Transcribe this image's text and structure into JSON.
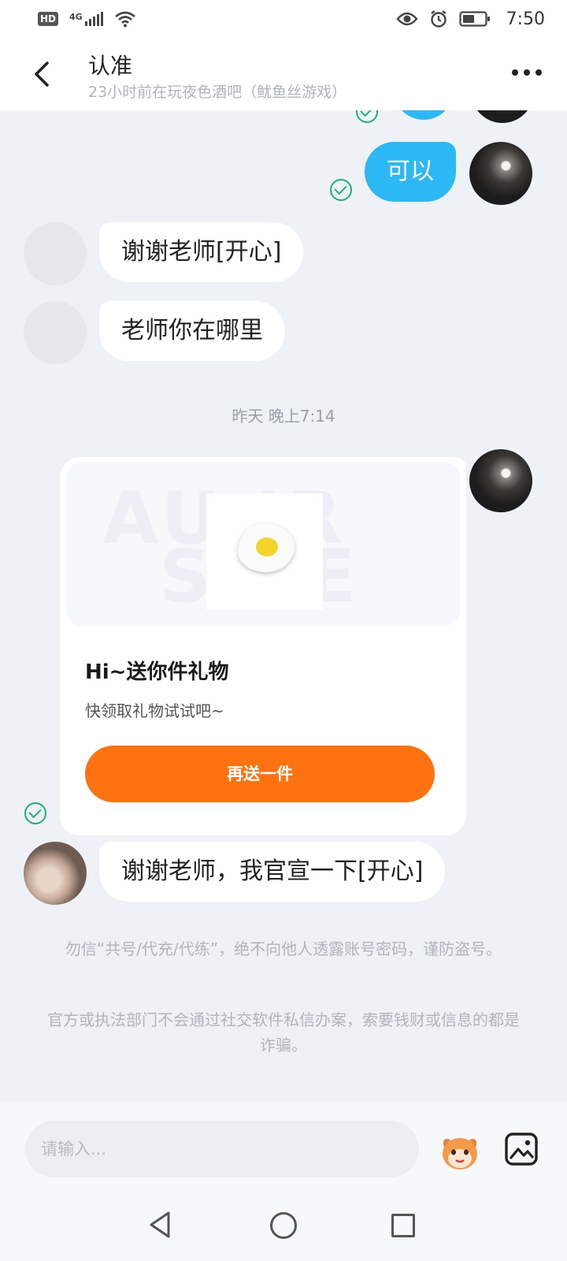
{
  "status_bar": {
    "badge": "HD",
    "network": "4G",
    "time": "7:50"
  },
  "header": {
    "title": "认准",
    "subtitle": "23小时前在玩夜色酒吧（鱿鱼丝游戏）"
  },
  "messages": [
    {
      "side": "right",
      "text": "可以",
      "status": "read"
    },
    {
      "side": "left",
      "text": "谢谢老师[开心]"
    },
    {
      "side": "left",
      "text": "老师你在哪里"
    }
  ],
  "timestamp": "昨天 晚上7:14",
  "gift_card": {
    "banner_text_top": "AU    IR",
    "banner_text_bottom": "S      RE",
    "title": "Hi~送你件礼物",
    "description": "快领取礼物试试吧~",
    "button_label": "再送一件",
    "status": "read"
  },
  "last_message": {
    "side": "left",
    "text": "谢谢老师，我官宣一下[开心]"
  },
  "notices": [
    "勿信“共号/代充/代练”，绝不向他人透露账号密码，谨防盗号。",
    "官方或执法部门不会通过社交软件私信办案，索要钱财或信息的都是诈骗。"
  ],
  "input": {
    "placeholder": "请输入..."
  },
  "colors": {
    "outgoing_bubble": "#2bb8f5",
    "gift_button": "#ff7212",
    "read_check": "#1cae84"
  }
}
